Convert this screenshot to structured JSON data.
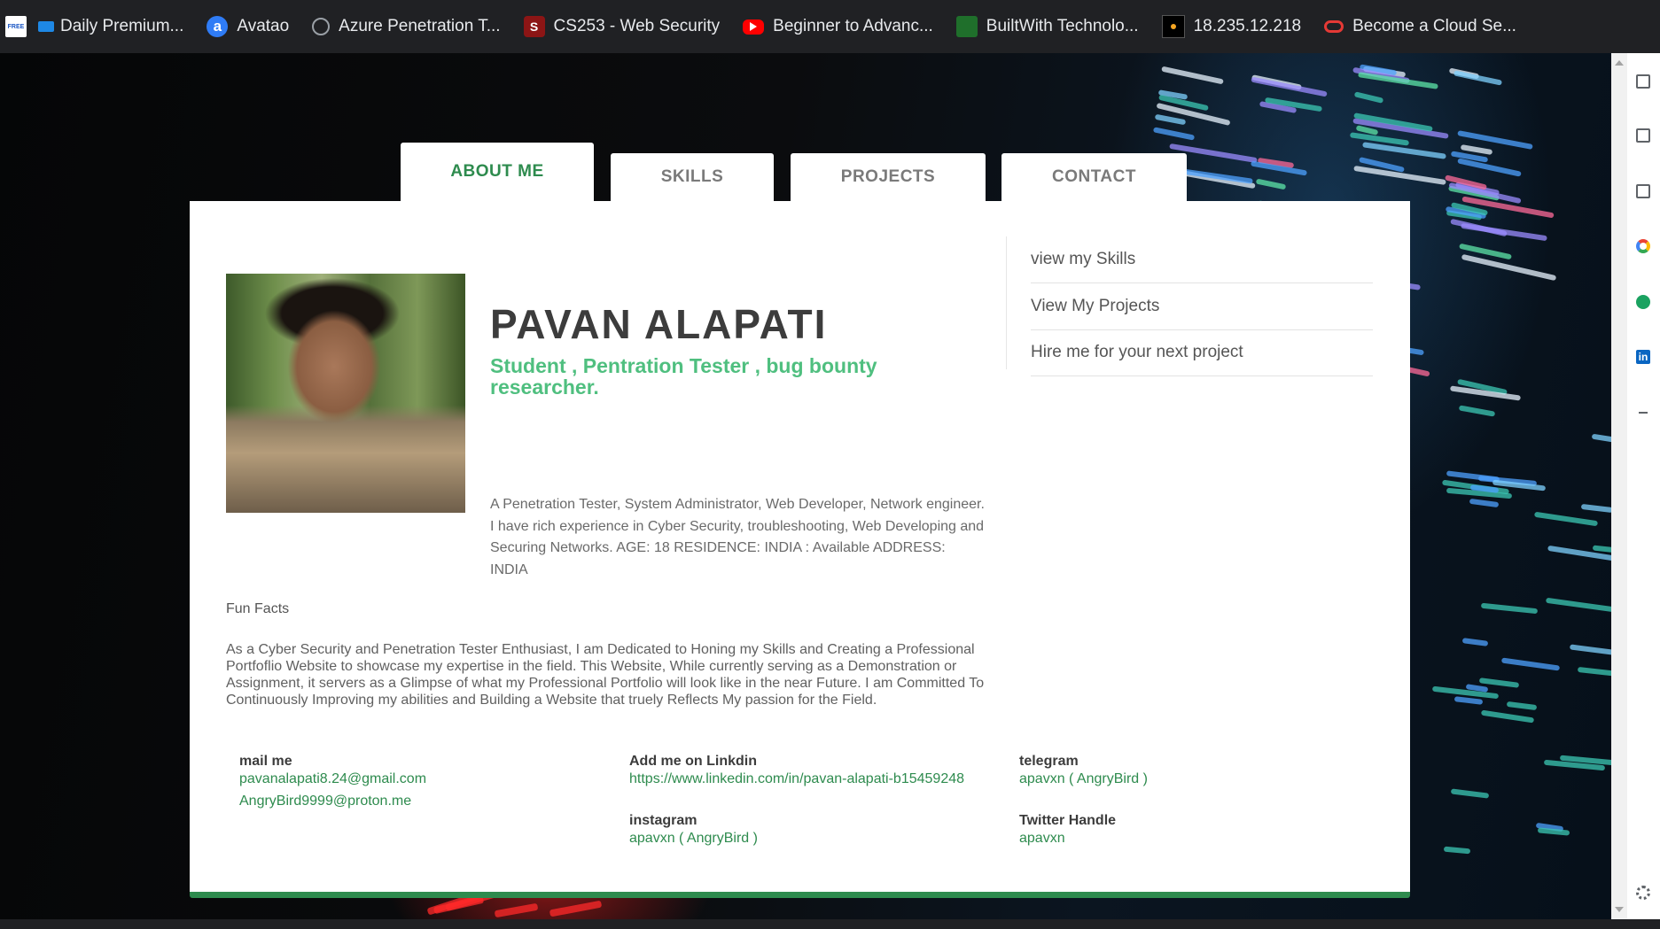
{
  "bookmarks": [
    {
      "label": "Daily Premium...",
      "icon": "ticket-icon",
      "badge": "FREE"
    },
    {
      "label": "Avatao",
      "icon": "avatao-icon",
      "glyph": "a"
    },
    {
      "label": "Azure Penetration T...",
      "icon": "globe-icon"
    },
    {
      "label": "CS253 - Web Security",
      "icon": "stanford-icon",
      "glyph": "S"
    },
    {
      "label": "Beginner to Advanc...",
      "icon": "youtube-icon"
    },
    {
      "label": "BuiltWith Technolo...",
      "icon": "builtwith-icon"
    },
    {
      "label": "18.235.12.218",
      "icon": "ip-icon"
    },
    {
      "label": "Become a Cloud Se...",
      "icon": "oracle-icon"
    }
  ],
  "tabs": [
    {
      "label": "ABOUT ME",
      "active": true
    },
    {
      "label": "SKILLS",
      "active": false
    },
    {
      "label": "PROJECTS",
      "active": false
    },
    {
      "label": "CONTACT",
      "active": false
    }
  ],
  "profile": {
    "name": "PAVAN ALAPATI",
    "subtitle": "Student , Pentration Tester , bug bounty researcher.",
    "bio": "A Penetration Tester, System Administrator, Web Developer, Network engineer. I have rich experience in Cyber Security, troubleshooting, Web Developing and Securing Networks. AGE: 18 RESIDENCE: INDIA : Available ADDRESS: INDIA"
  },
  "fun_facts": {
    "title": "Fun Facts",
    "text": "As a Cyber Security and Penetration Tester Enthusiast, I am Dedicated to Honing my Skills and Creating a Professional Portfoflio Website to showcase my expertise in the field. This Website, While currently serving as a Demonstration or Assignment, it servers as a Glimpse of what my Professional Portfolio will look like in the near Future. I am Committed To Continuously Improving my abilities and Building a Website that truely Reflects My passion for the Field."
  },
  "contacts": {
    "mail": {
      "label": "mail me",
      "links": [
        "pavanalapati8.24@gmail.com",
        "AngryBird9999@proton.me"
      ]
    },
    "linkedin": {
      "label": "Add me on Linkdin",
      "link": "https://www.linkedin.com/in/pavan-alapati-b15459248"
    },
    "telegram": {
      "label": "telegram",
      "link": "apavxn ( AngryBird )"
    },
    "instagram": {
      "label": "instagram",
      "link": "apavxn ( AngryBird )"
    },
    "twitter": {
      "label": "Twitter Handle",
      "link": "apavxn"
    }
  },
  "side_menu": [
    "view my Skills",
    "View My Projects",
    "Hire me for your next project"
  ],
  "colors": {
    "accent": "#2e8b4e",
    "accent_light": "#4fbf7f",
    "bookmark_bar": "#202124"
  }
}
